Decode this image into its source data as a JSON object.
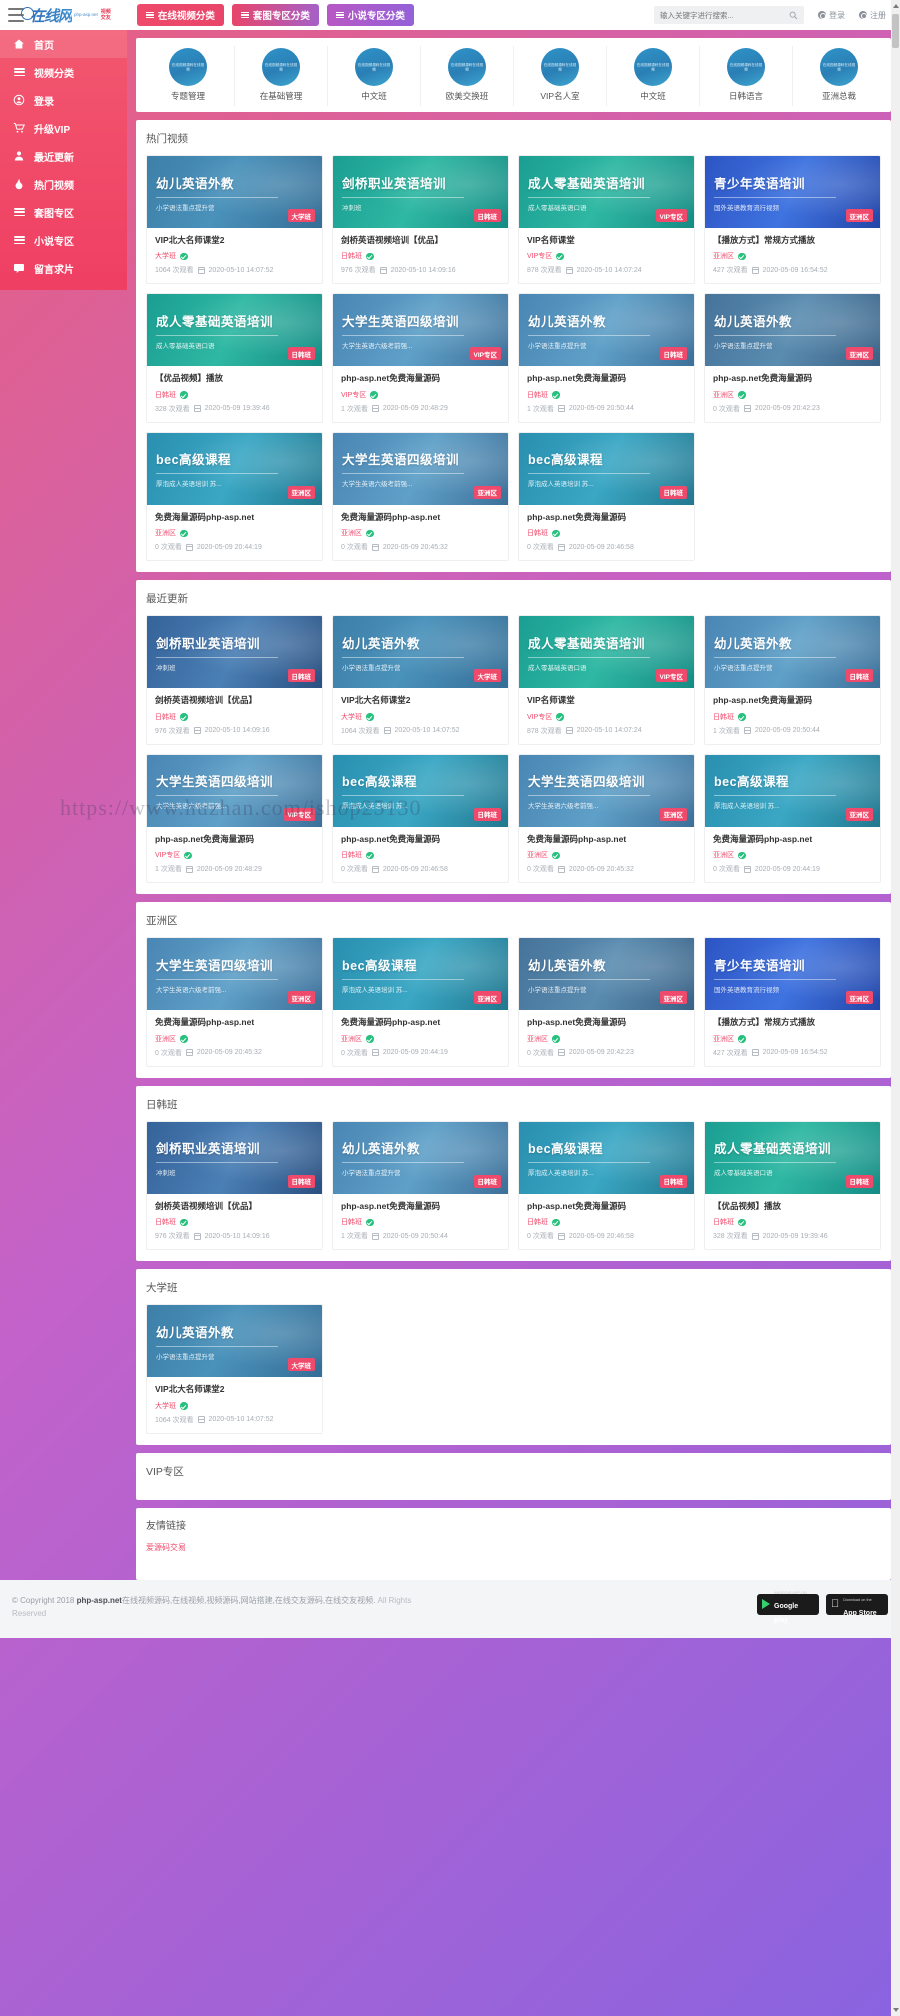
{
  "header": {
    "menu_icon": "hamburger-icon",
    "logo_text": "在线网",
    "logo_sub": "php-asp.net",
    "logo_badge": "视频\n交友",
    "nav_buttons": [
      {
        "label": "在线视频分类",
        "style": "nb1"
      },
      {
        "label": "套图专区分类",
        "style": "nb2"
      },
      {
        "label": "小说专区分类",
        "style": "nb3"
      }
    ],
    "search": {
      "placeholder": "输入关键字进行搜索...",
      "value": "",
      "icon": "search-icon"
    },
    "login_label": "登录",
    "register_label": "注册"
  },
  "sidebar": {
    "items": [
      {
        "label": "首页",
        "icon": "home-icon",
        "active": true
      },
      {
        "label": "视频分类",
        "icon": "list-icon",
        "active": false
      },
      {
        "label": "登录",
        "icon": "user-icon",
        "active": false
      },
      {
        "label": "升级VIP",
        "icon": "cart-icon",
        "active": false
      },
      {
        "label": "最近更新",
        "icon": "person-icon",
        "active": false
      },
      {
        "label": "热门视频",
        "icon": "fire-icon",
        "active": false
      },
      {
        "label": "套图专区",
        "icon": "list-icon",
        "active": false
      },
      {
        "label": "小说专区",
        "icon": "list-icon",
        "active": false
      },
      {
        "label": "留言求片",
        "icon": "message-icon",
        "active": false
      }
    ]
  },
  "categories": [
    {
      "label": "专题管理",
      "icon_text": "在线视频源码在线视频"
    },
    {
      "label": "在基础管理",
      "icon_text": "在线视频源码在线视频"
    },
    {
      "label": "中文班",
      "icon_text": "在线视频源码在线视频"
    },
    {
      "label": "欧美交换班",
      "icon_text": "在线视频源码在线视频"
    },
    {
      "label": "VIP名人室",
      "icon_text": "在线视频源码在线视频"
    },
    {
      "label": "中文班",
      "icon_text": "在线视频源码在线视频"
    },
    {
      "label": "日韩语言",
      "icon_text": "在线视频源码在线视频"
    },
    {
      "label": "亚洲总裁",
      "icon_text": "在线视频源码在线视频"
    }
  ],
  "sections": [
    {
      "title": "热门视频",
      "cards": [
        {
          "thumb_title": "幼儿英语外教",
          "thumb_sub": "小学语法重点提升营",
          "thumb_tag": "大学班",
          "theme": "t-blue",
          "title": "VIP北大名师课堂2",
          "cat": "大学班",
          "views": "1064 次观看",
          "date": "2020-05-10 14:07:52"
        },
        {
          "thumb_title": "剑桥职业英语培训",
          "thumb_sub": "冲刺班",
          "thumb_tag": "日韩班",
          "theme": "t-teal",
          "title": "剑桥英语视频培训【优品】",
          "cat": "日韩班",
          "views": "976 次观看",
          "date": "2020-05-10 14:09:16"
        },
        {
          "thumb_title": "成人零基础英语培训",
          "thumb_sub": "成人零基础英语口语",
          "thumb_tag": "VIP专区",
          "theme": "t-teal",
          "title": "VIP名师课堂",
          "cat": "VIP专区",
          "views": "878 次观看",
          "date": "2020-05-10 14:07:24"
        },
        {
          "thumb_title": "青少年英语培训",
          "thumb_sub": "国外英语教育流行视频",
          "thumb_tag": "亚洲区",
          "theme": "t-indigo",
          "title": "【播放方式】常规方式播放",
          "cat": "亚洲区",
          "views": "427 次观看",
          "date": "2020-05-09 16:54:52"
        },
        {
          "thumb_title": "成人零基础英语培训",
          "thumb_sub": "成人零基础英语口语",
          "thumb_tag": "日韩班",
          "theme": "t-teal",
          "title": "【优品视频】播放",
          "cat": "日韩班",
          "views": "328 次观看",
          "date": "2020-05-09 19:39:46"
        },
        {
          "thumb_title": "大学生英语四级培训",
          "thumb_sub": "大学生英语六级考前强...",
          "thumb_tag": "VIP专区",
          "theme": "t-sky",
          "title": "php-asp.net免费海量源码",
          "cat": "VIP专区",
          "views": "1 次观看",
          "date": "2020-05-09 20:48:29"
        },
        {
          "thumb_title": "幼儿英语外教",
          "thumb_sub": "小学语法重点提升营",
          "thumb_tag": "日韩班",
          "theme": "t-sky",
          "title": "php-asp.net免费海量源码",
          "cat": "日韩班",
          "views": "1 次观看",
          "date": "2020-05-09 20:50:44"
        },
        {
          "thumb_title": "幼儿英语外教",
          "thumb_sub": "小学语法重点提升营",
          "thumb_tag": "亚洲区",
          "theme": "t-steel",
          "title": "php-asp.net免费海量源码",
          "cat": "亚洲区",
          "views": "0 次观看",
          "date": "2020-05-09 20:42:23"
        },
        {
          "thumb_title": "bec高级课程",
          "thumb_sub": "厚泡成人英语培训 苏...",
          "thumb_tag": "亚洲区",
          "theme": "t-cyan",
          "title": "免费海量源码php-asp.net",
          "cat": "亚洲区",
          "views": "0 次观看",
          "date": "2020-05-09 20:44:19"
        },
        {
          "thumb_title": "大学生英语四级培训",
          "thumb_sub": "大学生英语六级考前强...",
          "thumb_tag": "亚洲区",
          "theme": "t-sky",
          "title": "免费海量源码php-asp.net",
          "cat": "亚洲区",
          "views": "0 次观看",
          "date": "2020-05-09 20:45:32"
        },
        {
          "thumb_title": "bec高级课程",
          "thumb_sub": "厚泡成人英语培训 苏...",
          "thumb_tag": "日韩班",
          "theme": "t-cyan",
          "title": "php-asp.net免费海量源码",
          "cat": "日韩班",
          "views": "0 次观看",
          "date": "2020-05-09 20:46:58"
        }
      ]
    },
    {
      "title": "最近更新",
      "cards": [
        {
          "thumb_title": "剑桥职业英语培训",
          "thumb_sub": "冲刺班",
          "thumb_tag": "日韩班",
          "theme": "t-navy",
          "title": "剑桥英语视频培训【优品】",
          "cat": "日韩班",
          "views": "976 次观看",
          "date": "2020-05-10 14:09:16"
        },
        {
          "thumb_title": "幼儿英语外教",
          "thumb_sub": "小学语法重点提升营",
          "thumb_tag": "大学班",
          "theme": "t-blue",
          "title": "VIP北大名师课堂2",
          "cat": "大学班",
          "views": "1064 次观看",
          "date": "2020-05-10 14:07:52"
        },
        {
          "thumb_title": "成人零基础英语培训",
          "thumb_sub": "成人零基础英语口语",
          "thumb_tag": "VIP专区",
          "theme": "t-teal",
          "title": "VIP名师课堂",
          "cat": "VIP专区",
          "views": "878 次观看",
          "date": "2020-05-10 14:07:24"
        },
        {
          "thumb_title": "幼儿英语外教",
          "thumb_sub": "小学语法重点提升营",
          "thumb_tag": "日韩班",
          "theme": "t-sky",
          "title": "php-asp.net免费海量源码",
          "cat": "日韩班",
          "views": "1 次观看",
          "date": "2020-05-09 20:50:44"
        },
        {
          "thumb_title": "大学生英语四级培训",
          "thumb_sub": "大学生英语六级考前强...",
          "thumb_tag": "VIP专区",
          "theme": "t-sky",
          "title": "php-asp.net免费海量源码",
          "cat": "VIP专区",
          "views": "1 次观看",
          "date": "2020-05-09 20:48:29"
        },
        {
          "thumb_title": "bec高级课程",
          "thumb_sub": "厚泡成人英语培训 苏...",
          "thumb_tag": "日韩班",
          "theme": "t-cyan",
          "title": "php-asp.net免费海量源码",
          "cat": "日韩班",
          "views": "0 次观看",
          "date": "2020-05-09 20:46:58"
        },
        {
          "thumb_title": "大学生英语四级培训",
          "thumb_sub": "大学生英语六级考前强...",
          "thumb_tag": "亚洲区",
          "theme": "t-sky",
          "title": "免费海量源码php-asp.net",
          "cat": "亚洲区",
          "views": "0 次观看",
          "date": "2020-05-09 20:45:32"
        },
        {
          "thumb_title": "bec高级课程",
          "thumb_sub": "厚泡成人英语培训 苏...",
          "thumb_tag": "亚洲区",
          "theme": "t-cyan",
          "title": "免费海量源码php-asp.net",
          "cat": "亚洲区",
          "views": "0 次观看",
          "date": "2020-05-09 20:44:19"
        }
      ]
    },
    {
      "title": "亚洲区",
      "cards": [
        {
          "thumb_title": "大学生英语四级培训",
          "thumb_sub": "大学生英语六级考前强...",
          "thumb_tag": "亚洲区",
          "theme": "t-sky",
          "title": "免费海量源码php-asp.net",
          "cat": "亚洲区",
          "views": "0 次观看",
          "date": "2020-05-09 20:45:32"
        },
        {
          "thumb_title": "bec高级课程",
          "thumb_sub": "厚泡成人英语培训 苏...",
          "thumb_tag": "亚洲区",
          "theme": "t-cyan",
          "title": "免费海量源码php-asp.net",
          "cat": "亚洲区",
          "views": "0 次观看",
          "date": "2020-05-09 20:44:19"
        },
        {
          "thumb_title": "幼儿英语外教",
          "thumb_sub": "小学语法重点提升营",
          "thumb_tag": "亚洲区",
          "theme": "t-steel",
          "title": "php-asp.net免费海量源码",
          "cat": "亚洲区",
          "views": "0 次观看",
          "date": "2020-05-09 20:42:23"
        },
        {
          "thumb_title": "青少年英语培训",
          "thumb_sub": "国外英语教育流行视频",
          "thumb_tag": "亚洲区",
          "theme": "t-indigo",
          "title": "【播放方式】常规方式播放",
          "cat": "亚洲区",
          "views": "427 次观看",
          "date": "2020-05-09 16:54:52"
        }
      ]
    },
    {
      "title": "日韩班",
      "cards": [
        {
          "thumb_title": "剑桥职业英语培训",
          "thumb_sub": "冲刺班",
          "thumb_tag": "日韩班",
          "theme": "t-navy",
          "title": "剑桥英语视频培训【优品】",
          "cat": "日韩班",
          "views": "976 次观看",
          "date": "2020-05-10 14:09:16"
        },
        {
          "thumb_title": "幼儿英语外教",
          "thumb_sub": "小学语法重点提升营",
          "thumb_tag": "日韩班",
          "theme": "t-sky",
          "title": "php-asp.net免费海量源码",
          "cat": "日韩班",
          "views": "1 次观看",
          "date": "2020-05-09 20:50:44"
        },
        {
          "thumb_title": "bec高级课程",
          "thumb_sub": "厚泡成人英语培训 苏...",
          "thumb_tag": "日韩班",
          "theme": "t-cyan",
          "title": "php-asp.net免费海量源码",
          "cat": "日韩班",
          "views": "0 次观看",
          "date": "2020-05-09 20:46:58"
        },
        {
          "thumb_title": "成人零基础英语培训",
          "thumb_sub": "成人零基础英语口语",
          "thumb_tag": "日韩班",
          "theme": "t-teal",
          "title": "【优品视频】播放",
          "cat": "日韩班",
          "views": "328 次观看",
          "date": "2020-05-09 19:39:46"
        }
      ]
    },
    {
      "title": "大学班",
      "cards": [
        {
          "thumb_title": "幼儿英语外教",
          "thumb_sub": "小学语法重点提升营",
          "thumb_tag": "大学班",
          "theme": "t-blue",
          "title": "VIP北大名师课堂2",
          "cat": "大学班",
          "views": "1064 次观看",
          "date": "2020-05-10 14:07:52"
        }
      ]
    }
  ],
  "vip_section": {
    "title": "VIP专区"
  },
  "friend_links": {
    "title": "友情链接",
    "links": [
      "爱源码交易"
    ]
  },
  "watermark": "https://www.huzhan.com/ishop25130",
  "footer": {
    "copyright_prefix": "© Copyright 2018",
    "brand": "php-asp.net",
    "desc": "在线视频源码,在线视频,视频源码,网站搭建,在线交友源码,在线交友视频.",
    "rights": "All Rights Reserved",
    "stores": [
      {
        "top": "ANDROID APP ON",
        "name": "Google play",
        "icon": "google-play-icon"
      },
      {
        "top": "Download on the",
        "name": "App Store",
        "icon": "apple-icon"
      }
    ]
  }
}
